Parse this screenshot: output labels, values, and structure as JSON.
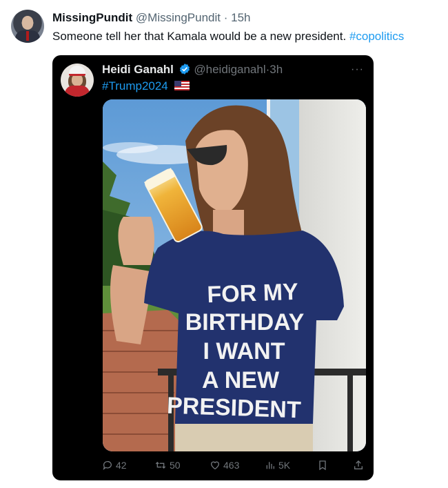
{
  "outer": {
    "name": "MissingPundit",
    "handle": "@MissingPundit",
    "sep": " · ",
    "time": "15h",
    "text": "Someone tell her that Kamala would be a new president. ",
    "hashtag": "#copolitics"
  },
  "quoted": {
    "name": "Heidi Ganahl",
    "handle": "@heidiganahl",
    "sep": "·",
    "time": "3h",
    "hashtag": "#Trump2024",
    "more": "···",
    "shirt_lines": [
      "FOR MY",
      "BIRTHDAY",
      "I WANT",
      "A NEW",
      "PRESIDENT"
    ],
    "actions": {
      "replies": "42",
      "reposts": "50",
      "likes": "463",
      "views": "5K"
    }
  },
  "icons": [
    "verified-badge-icon",
    "us-flag-icon",
    "reply-icon",
    "repost-icon",
    "like-icon",
    "views-icon",
    "bookmark-icon",
    "share-icon",
    "more-icon"
  ]
}
